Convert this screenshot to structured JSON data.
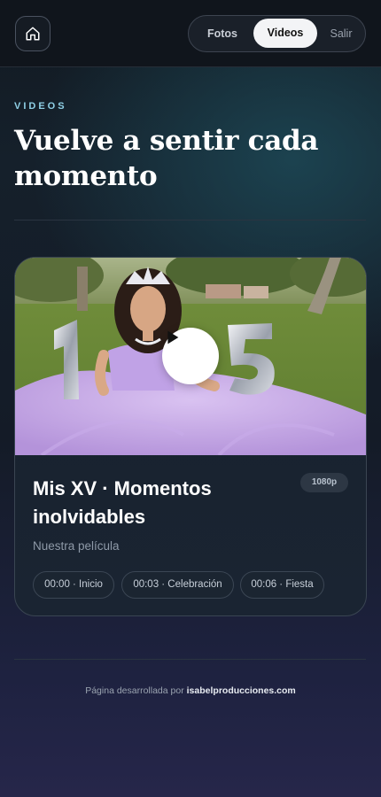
{
  "header": {
    "home_icon": "home-icon",
    "tabs": [
      {
        "label": "Fotos",
        "active": false
      },
      {
        "label": "Videos",
        "active": true
      },
      {
        "label": "Salir",
        "active": false
      }
    ]
  },
  "hero": {
    "eyebrow": "VIDEOS",
    "title": "Vuelve a sentir cada momento"
  },
  "video_card": {
    "title": "Mis XV · Momentos inolvidables",
    "resolution": "1080p",
    "subtitle": "Nuestra película",
    "play_icon": "play-icon",
    "chapters": [
      {
        "label": "00:00 · Inicio"
      },
      {
        "label": "00:03 · Celebración"
      },
      {
        "label": "00:06 · Fiesta"
      }
    ]
  },
  "footer": {
    "prefix": "Página desarrollada por",
    "site": "isabelproducciones.com"
  },
  "colors": {
    "accent": "#8fd0e6",
    "active_tab_bg": "#f3f4f6",
    "card_bg": "#17212d",
    "dress": "#c7a8e6"
  }
}
